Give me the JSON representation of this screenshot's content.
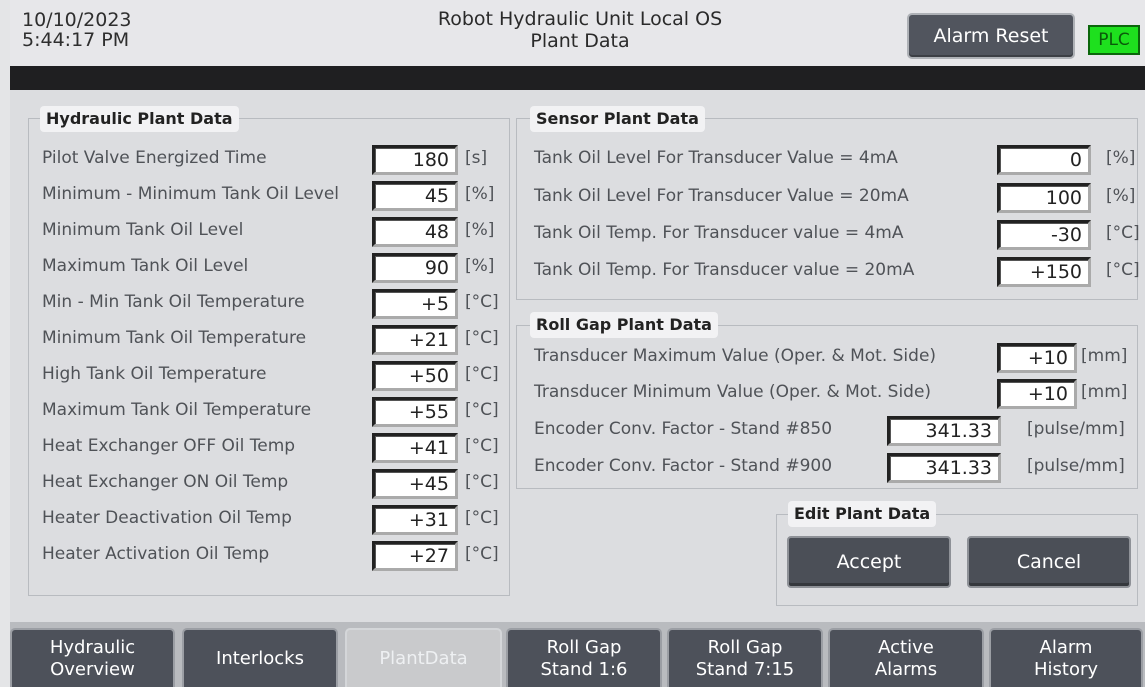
{
  "header": {
    "date": "10/10/2023",
    "time": "5:44:17 PM",
    "title_line1": "Robot Hydraulic Unit Local OS",
    "title_line2": "Plant Data",
    "alarm_reset_label": "Alarm Reset",
    "plc_label": "PLC"
  },
  "hydraulic": {
    "title": "Hydraulic Plant Data",
    "rows": [
      {
        "label": "Pilot Valve Energized Time",
        "value": "180",
        "unit": "[s]"
      },
      {
        "label": "Minimum - Minimum Tank Oil Level",
        "value": "45",
        "unit": "[%]"
      },
      {
        "label": "Minimum Tank Oil Level",
        "value": "48",
        "unit": "[%]"
      },
      {
        "label": "Maximum Tank Oil Level",
        "value": "90",
        "unit": "[%]"
      },
      {
        "label": "Min - Min Tank Oil Temperature",
        "value": "+5",
        "unit": "[°C]"
      },
      {
        "label": "Minimum Tank Oil Temperature",
        "value": "+21",
        "unit": "[°C]"
      },
      {
        "label": "High Tank Oil Temperature",
        "value": "+50",
        "unit": "[°C]"
      },
      {
        "label": "Maximum Tank Oil Temperature",
        "value": "+55",
        "unit": "[°C]"
      },
      {
        "label": "Heat Exchanger OFF Oil Temp",
        "value": "+41",
        "unit": "[°C]"
      },
      {
        "label": "Heat Exchanger ON Oil Temp",
        "value": "+45",
        "unit": "[°C]"
      },
      {
        "label": "Heater Deactivation Oil Temp",
        "value": "+31",
        "unit": "[°C]"
      },
      {
        "label": "Heater Activation Oil Temp",
        "value": "+27",
        "unit": "[°C]"
      }
    ]
  },
  "sensor": {
    "title": "Sensor Plant Data",
    "rows": [
      {
        "label": "Tank Oil Level For Transducer Value = 4mA",
        "value": "0",
        "unit": "[%]"
      },
      {
        "label": "Tank Oil Level For Transducer Value = 20mA",
        "value": "100",
        "unit": "[%]"
      },
      {
        "label": "Tank Oil Temp. For Transducer value = 4mA",
        "value": "-30",
        "unit": "[°C]"
      },
      {
        "label": "Tank Oil Temp. For Transducer value = 20mA",
        "value": "+150",
        "unit": "[°C]"
      }
    ]
  },
  "rollgap": {
    "title": "Roll Gap Plant Data",
    "rows": [
      {
        "label": "Transducer Maximum Value (Oper. & Mot. Side)",
        "value": "+10",
        "unit": "[mm]"
      },
      {
        "label": "Transducer Minimum Value (Oper. & Mot. Side)",
        "value": "+10",
        "unit": "[mm]"
      },
      {
        "label": "Encoder Conv. Factor - Stand #850",
        "value": "341.33",
        "unit": "[pulse/mm]"
      },
      {
        "label": "Encoder Conv. Factor - Stand #900",
        "value": "341.33",
        "unit": "[pulse/mm]"
      }
    ]
  },
  "edit": {
    "title": "Edit Plant Data",
    "accept_label": "Accept",
    "cancel_label": "Cancel"
  },
  "nav": {
    "tabs": [
      {
        "line1": "Hydraulic",
        "line2": "Overview"
      },
      {
        "line1": "Interlocks",
        "line2": ""
      },
      {
        "line1": "PlantData",
        "line2": ""
      },
      {
        "line1": "Roll Gap",
        "line2": "Stand 1:6"
      },
      {
        "line1": "Roll Gap",
        "line2": "Stand 7:15"
      },
      {
        "line1": "Active",
        "line2": "Alarms"
      },
      {
        "line1": "Alarm",
        "line2": "History"
      }
    ]
  },
  "colors": {
    "plc_green": "#1ee01e",
    "button_dark": "#4b4f57",
    "header_bar": "#1f1f21"
  }
}
